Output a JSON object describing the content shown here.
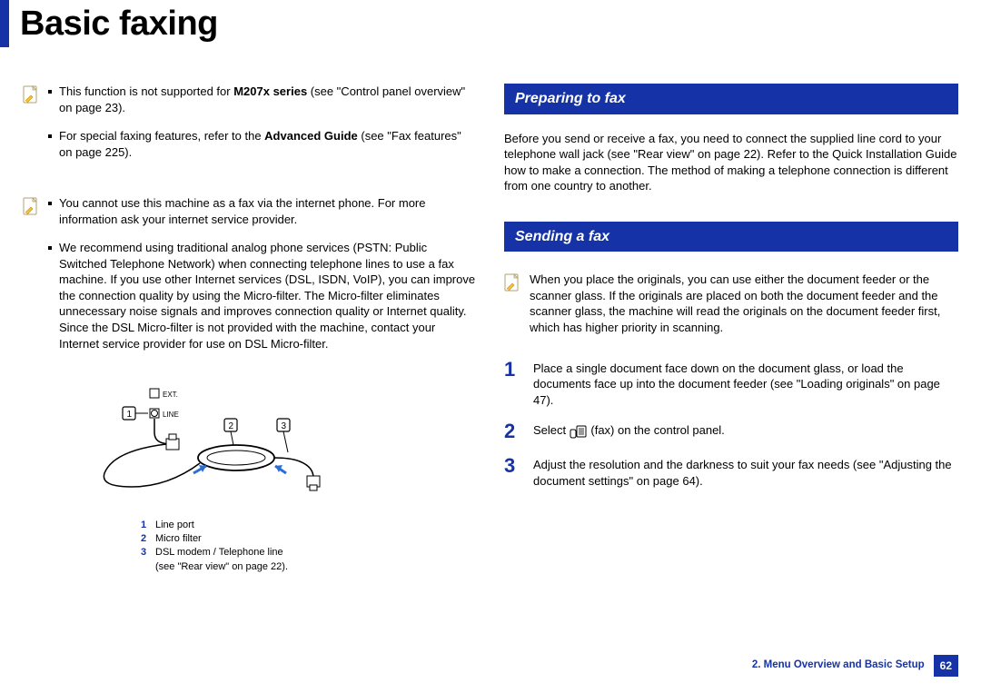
{
  "page_title": "Basic faxing",
  "left": {
    "note1": {
      "b1_pre": "This function is not supported for ",
      "b1_bold": "M207x series",
      "b1_post": " (see \"Control panel overview\" on page 23).",
      "b2_pre": "For special faxing features, refer to the ",
      "b2_bold": "Advanced Guide",
      "b2_post": " (see \"Fax features\" on page 225)."
    },
    "note2": {
      "b1": "You cannot use this machine as a fax via the internet phone. For more information ask your internet service provider.",
      "b2": "We recommend using traditional analog phone services (PSTN: Public Switched Telephone Network) when connecting telephone lines to use a fax machine. If you use other Internet services (DSL, ISDN, VoIP), you can improve the connection quality by using the Micro-filter. The Micro-filter eliminates unnecessary noise signals and improves connection quality or Internet quality. Since the DSL Micro-filter is not provided with the machine, contact your Internet service provider for use on DSL Micro-filter."
    },
    "diagram_labels": {
      "ext": "EXT.",
      "line": "LINE",
      "k1": "1",
      "k2": "2",
      "k3": "3"
    },
    "legend": {
      "r1": "Line port",
      "r2": "Micro filter",
      "r3a": "DSL modem / Telephone line",
      "r3b": "(see \"Rear view\" on page 22)."
    }
  },
  "right": {
    "section1_title": "Preparing to fax",
    "section1_body": "Before you send or receive a fax, you need to connect the supplied line cord to your telephone wall jack (see \"Rear view\" on page 22). Refer to the Quick Installation Guide how to make a connection. The method of making a telephone connection is different from one country to another.",
    "section2_title": "Sending a fax",
    "note3": "When you place the originals, you can use either the document feeder or the scanner glass. If the originals are placed on both the document feeder and the scanner glass, the machine will read the originals on the document feeder first, which has higher priority in scanning.",
    "steps": {
      "n1": "1",
      "s1": "Place a single document face down on the document glass, or load the documents face up into the document feeder (see \"Loading originals\" on page 47).",
      "n2": "2",
      "s2a": "Select ",
      "s2b": " (fax) on the control panel.",
      "n3": "3",
      "s3": "Adjust the resolution and the darkness to suit your fax needs (see \"Adjusting the document settings\" on page 64)."
    }
  },
  "footer": {
    "chapter": "2. Menu Overview and Basic Setup",
    "page": "62"
  }
}
